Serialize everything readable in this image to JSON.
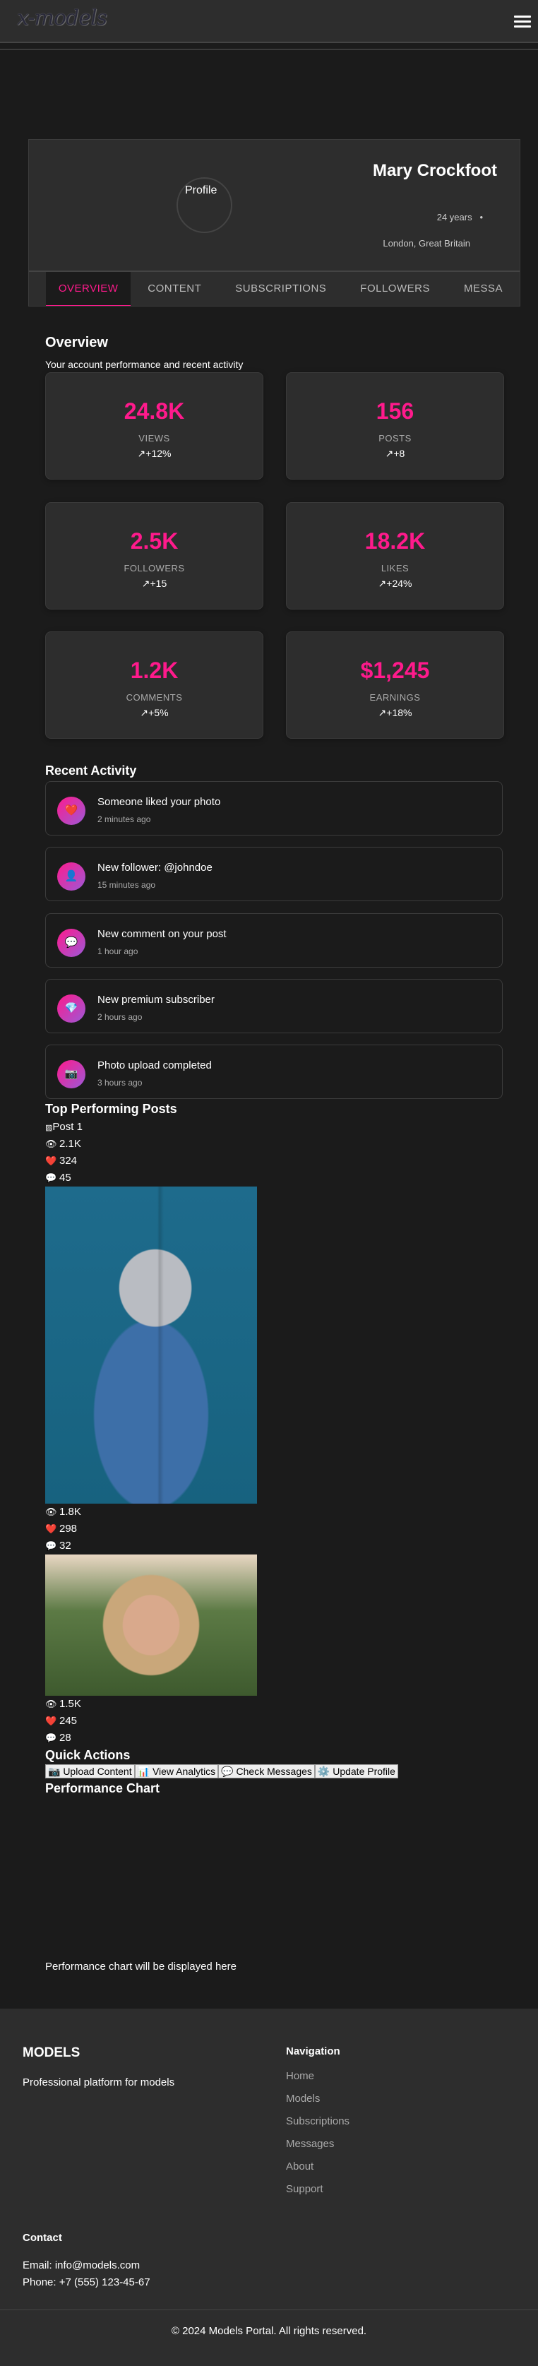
{
  "header": {
    "logo": "x-models"
  },
  "profile": {
    "avatar_alt": "Profile",
    "name": "Mary Crockfoot",
    "age": "24 years",
    "dot": "•",
    "location": "London, Great Britain"
  },
  "tabs": [
    "OVERVIEW",
    "CONTENT",
    "SUBSCRIPTIONS",
    "FOLLOWERS",
    "MESSA"
  ],
  "overview": {
    "title": "Overview",
    "subtitle": "Your account performance and recent activity",
    "stats": [
      {
        "value": "24.8K",
        "label": "VIEWS",
        "change": "↗+12%"
      },
      {
        "value": "156",
        "label": "POSTS",
        "change": "↗+8"
      },
      {
        "value": "2.5K",
        "label": "FOLLOWERS",
        "change": "↗+15"
      },
      {
        "value": "18.2K",
        "label": "LIKES",
        "change": "↗+24%"
      },
      {
        "value": "1.2K",
        "label": "COMMENTS",
        "change": "↗+5%"
      },
      {
        "value": "$1,245",
        "label": "EARNINGS",
        "change": "↗+18%"
      }
    ]
  },
  "activity": {
    "title": "Recent Activity",
    "items": [
      {
        "icon": "❤️",
        "text": "Someone liked your photo",
        "time": "2 minutes ago"
      },
      {
        "icon": "👤",
        "text": "New follower: @johndoe",
        "time": "15 minutes ago"
      },
      {
        "icon": "💬",
        "text": "New comment on your post",
        "time": "1 hour ago"
      },
      {
        "icon": "💎",
        "text": "New premium subscriber",
        "time": "2 hours ago"
      },
      {
        "icon": "📷",
        "text": "Photo upload completed",
        "time": "3 hours ago"
      }
    ]
  },
  "posts": {
    "title": "Top Performing Posts",
    "items": [
      {
        "alt": "Post 1",
        "views": "2.1K",
        "likes": "324",
        "comments": "45"
      },
      {
        "views": "1.8K",
        "likes": "298",
        "comments": "32"
      },
      {
        "views": "1.5K",
        "likes": "245",
        "comments": "28"
      }
    ],
    "icons": {
      "views": "👁",
      "likes": "❤️",
      "comments": "💬"
    }
  },
  "quick_actions": {
    "title": "Quick Actions",
    "buttons": [
      "📷 Upload Content",
      "📊 View Analytics",
      "💬 Check Messages",
      "⚙️ Update Profile"
    ]
  },
  "chart": {
    "title": "Performance Chart",
    "placeholder": "Performance chart will be displayed here"
  },
  "footer": {
    "brand": "MODELS",
    "tagline": "Professional platform for models",
    "nav_title": "Navigation",
    "nav": [
      "Home",
      "Models",
      "Subscriptions",
      "Messages",
      "About",
      "Support"
    ],
    "contact_title": "Contact",
    "email": "Email: info@models.com",
    "phone": "Phone: +7 (555) 123-45-67",
    "copyright": "© 2024 Models Portal. All rights reserved."
  },
  "colors": {
    "accent": "#ff1a8c",
    "bg": "#1b1b1b",
    "panel": "#2d2d2d"
  }
}
